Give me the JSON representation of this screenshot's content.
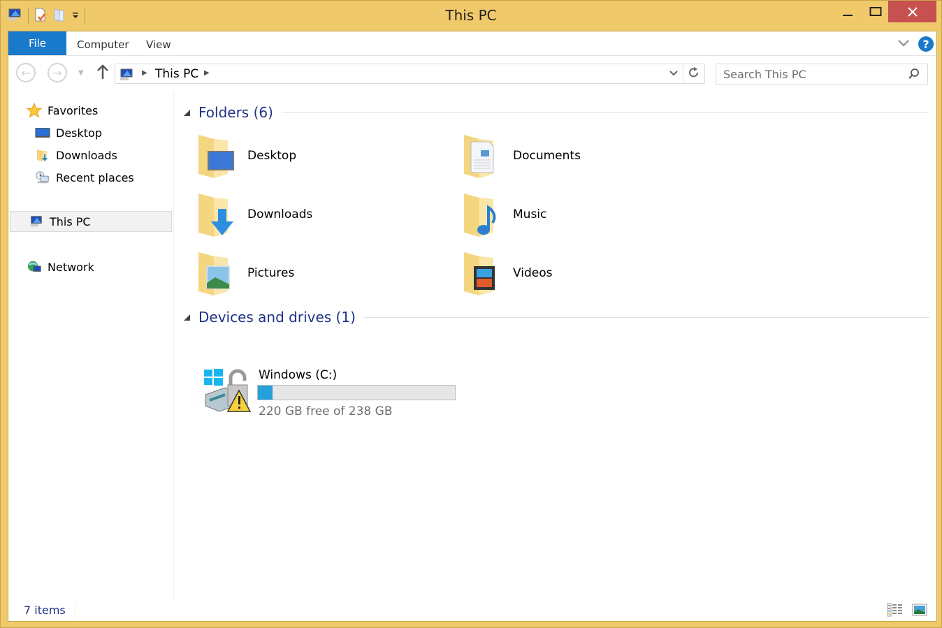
{
  "window": {
    "title": "This PC",
    "colors": {
      "frame": "#f0c96a",
      "close": "#c75050",
      "accent": "#1979ca",
      "group_header": "#1e3287",
      "drive_fill": "#26a0da"
    }
  },
  "quick_access": {
    "icons": [
      "computer-icon",
      "properties-icon",
      "new-folder-icon",
      "customize-dropdown-icon"
    ]
  },
  "ribbon": {
    "tabs": [
      {
        "label": "File",
        "active": true
      },
      {
        "label": "Computer"
      },
      {
        "label": "View"
      }
    ]
  },
  "navigation": {
    "back_icon": "arrow-left",
    "forward_icon": "arrow-right",
    "up_icon": "arrow-up",
    "breadcrumb": [
      "This PC"
    ],
    "search_placeholder": "Search This PC"
  },
  "nav_pane": {
    "favorites": {
      "label": "Favorites",
      "items": [
        "Desktop",
        "Downloads",
        "Recent places"
      ]
    },
    "this_pc": {
      "label": "This PC",
      "selected": true
    },
    "network": {
      "label": "Network"
    }
  },
  "content": {
    "folders_header": "Folders (6)",
    "folders": [
      {
        "name": "Desktop",
        "overlay": "monitor"
      },
      {
        "name": "Documents",
        "overlay": "document"
      },
      {
        "name": "Downloads",
        "overlay": "down-arrow"
      },
      {
        "name": "Music",
        "overlay": "music-note"
      },
      {
        "name": "Pictures",
        "overlay": "picture"
      },
      {
        "name": "Videos",
        "overlay": "film"
      }
    ],
    "drives_header": "Devices and drives (1)",
    "drives": [
      {
        "name": "Windows (C:)",
        "free_text": "220 GB free of 238 GB",
        "used_fraction": 0.076
      }
    ]
  },
  "status": {
    "item_count": "7 items",
    "view_buttons": [
      "details-view",
      "large-icons-view"
    ]
  }
}
